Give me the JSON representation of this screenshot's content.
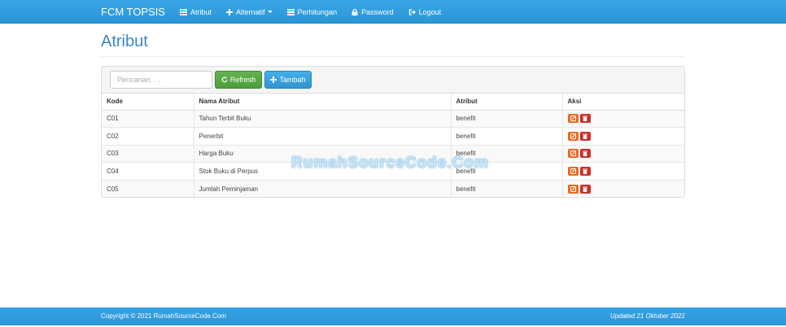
{
  "navbar": {
    "brand": "FCM TOPSIS",
    "items": [
      {
        "label": "Atribut",
        "icon": "grid-icon"
      },
      {
        "label": "Alternatif",
        "icon": "plus-icon"
      },
      {
        "label": "Perhitungan",
        "icon": "list-icon"
      },
      {
        "label": "Password",
        "icon": "lock-icon"
      },
      {
        "label": "Logout",
        "icon": "logout-icon"
      }
    ]
  },
  "page": {
    "title": "Atribut"
  },
  "toolbar": {
    "search_placeholder": "Pencarian. . .",
    "refresh_label": "Refresh",
    "add_label": "Tambah"
  },
  "table": {
    "headers": [
      "Kode",
      "Nama Atribut",
      "Atribut",
      "Aksi"
    ],
    "rows": [
      {
        "kode": "C01",
        "nama": "Tahun Terbit Buku",
        "atribut": "benefit"
      },
      {
        "kode": "C02",
        "nama": "Penerbit",
        "atribut": "benefit"
      },
      {
        "kode": "C03",
        "nama": "Harga Buku",
        "atribut": "benefit"
      },
      {
        "kode": "C04",
        "nama": "Stok Buku di Perpus",
        "atribut": "benefit"
      },
      {
        "kode": "C05",
        "nama": "Jumlah Peminjaman",
        "atribut": "benefit"
      }
    ]
  },
  "watermark": "RumahSourceCode.Com",
  "footer": {
    "copyright": "Copyright © 2021 RumahSourceCode.Com",
    "updated": "Updated 21 Oktober 2021"
  },
  "colors": {
    "nav": "#2b95d6",
    "title": "#3a89c9",
    "refresh": "#5cb85c",
    "add": "#3aa7e6",
    "edit": "#e86a1f",
    "delete": "#c9302c"
  }
}
